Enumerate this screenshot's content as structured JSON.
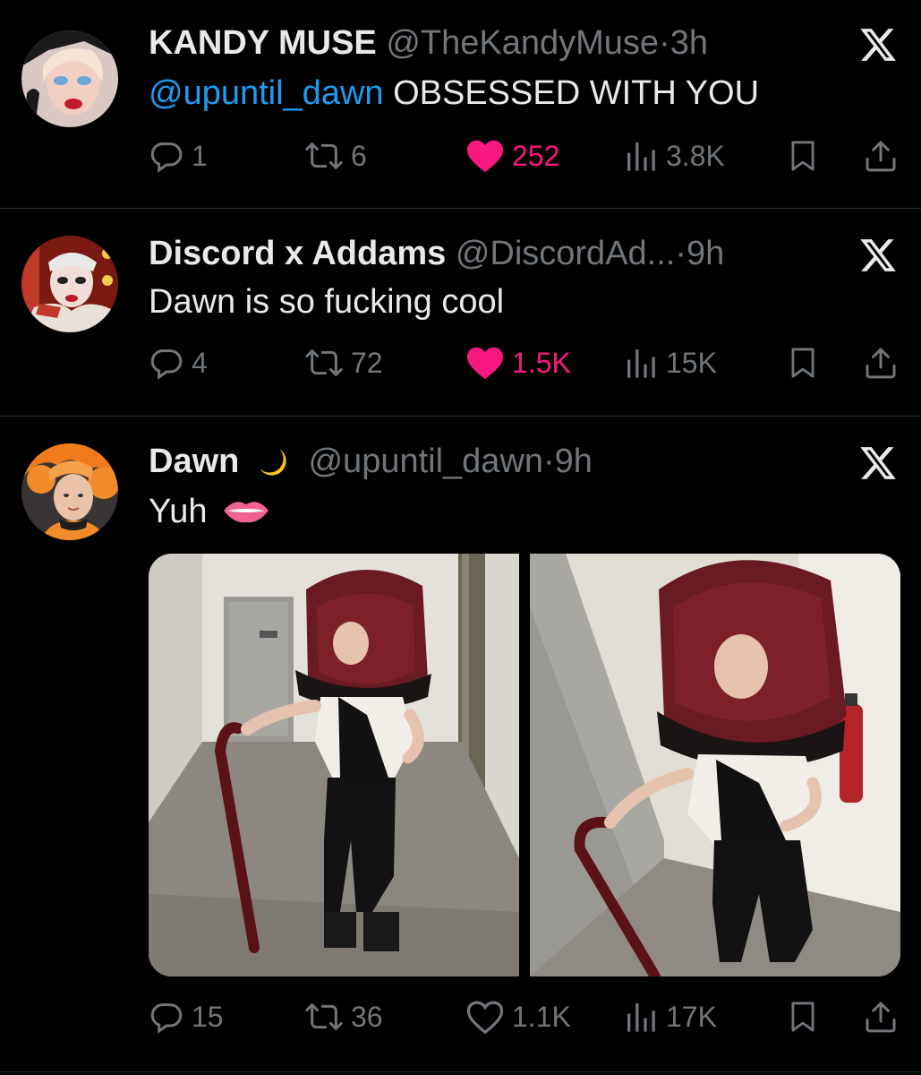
{
  "tweets": [
    {
      "name": "KANDY MUSE",
      "handle": "@TheKandyMuse",
      "time_sep": "·",
      "time": "3h",
      "mention": "@upuntil_dawn",
      "text": " OBSESSED WITH YOU",
      "replies": "1",
      "retweets": "6",
      "likes": "252",
      "liked": true,
      "views": "3.8K"
    },
    {
      "name": "Discord x Addams",
      "handle": "@DiscordAd...",
      "time_sep": "·",
      "time": "9h",
      "text": "Dawn is so fucking cool",
      "replies": "4",
      "retweets": "72",
      "likes": "1.5K",
      "liked": true,
      "views": "15K"
    },
    {
      "name": "Dawn",
      "name_emoji": "crescent-moon",
      "handle": "@upuntil_dawn",
      "time_sep": "·",
      "time": "9h",
      "text": "Yuh",
      "text_emoji": "lips",
      "replies": "15",
      "retweets": "36",
      "likes": "1.1K",
      "liked": false,
      "views": "17K",
      "media_count": 2
    }
  ],
  "colors": {
    "background": "#000000",
    "text": "#e7e9ea",
    "muted": "#71767b",
    "link": "#1d9bf0",
    "like": "#f91880",
    "divider": "#2f3336"
  },
  "icons": [
    "reply-icon",
    "retweet-icon",
    "like-icon",
    "views-icon",
    "bookmark-icon",
    "share-icon",
    "x-logo-icon"
  ]
}
